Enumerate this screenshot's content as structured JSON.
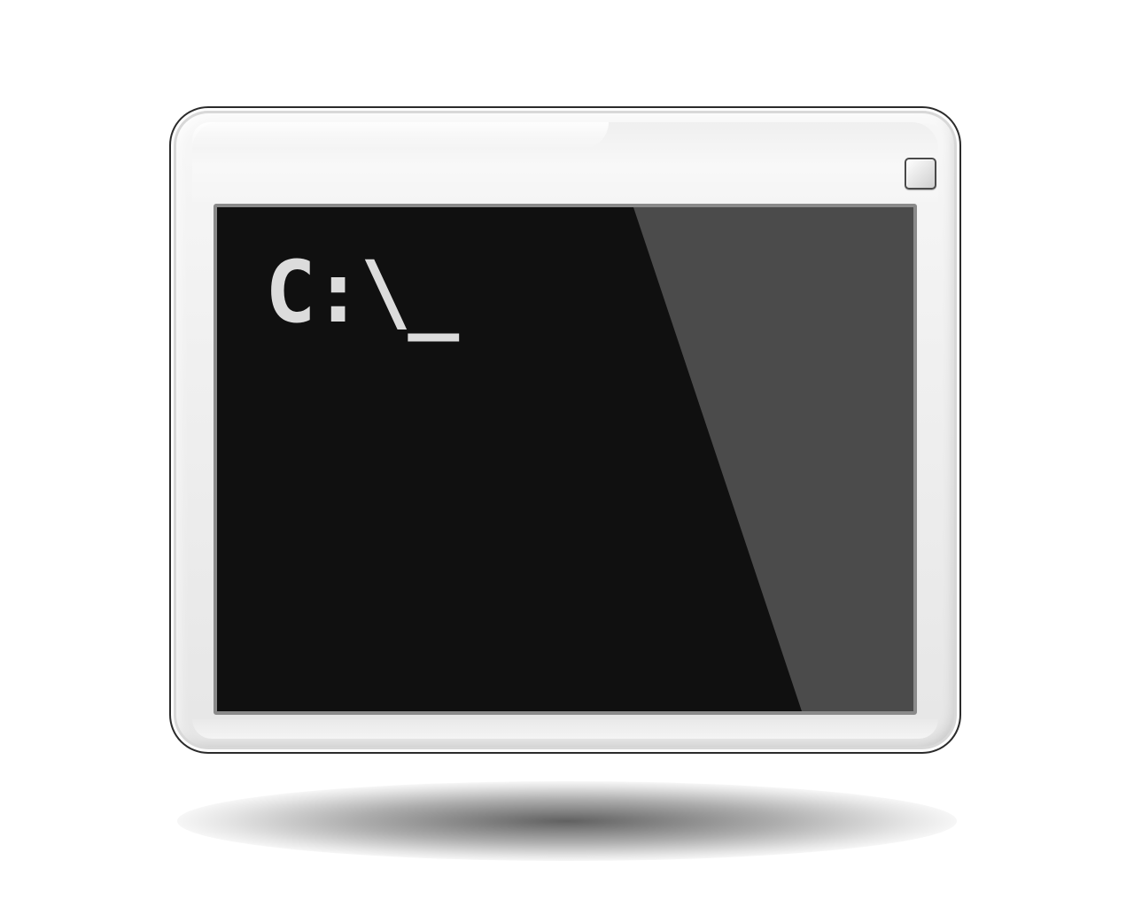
{
  "window": {
    "name": "console-window",
    "title_bar": {
      "button_icon": "maximize-icon"
    },
    "console": {
      "prompt": "C:\\_"
    }
  },
  "colors": {
    "frame": "#f0f0f0",
    "frame_outline": "#2b2b2b",
    "screen_background": "#101010",
    "screen_glare": "#4b4b4b",
    "prompt_text": "#dcdcdc",
    "screen_border": "#8a8a8a"
  }
}
